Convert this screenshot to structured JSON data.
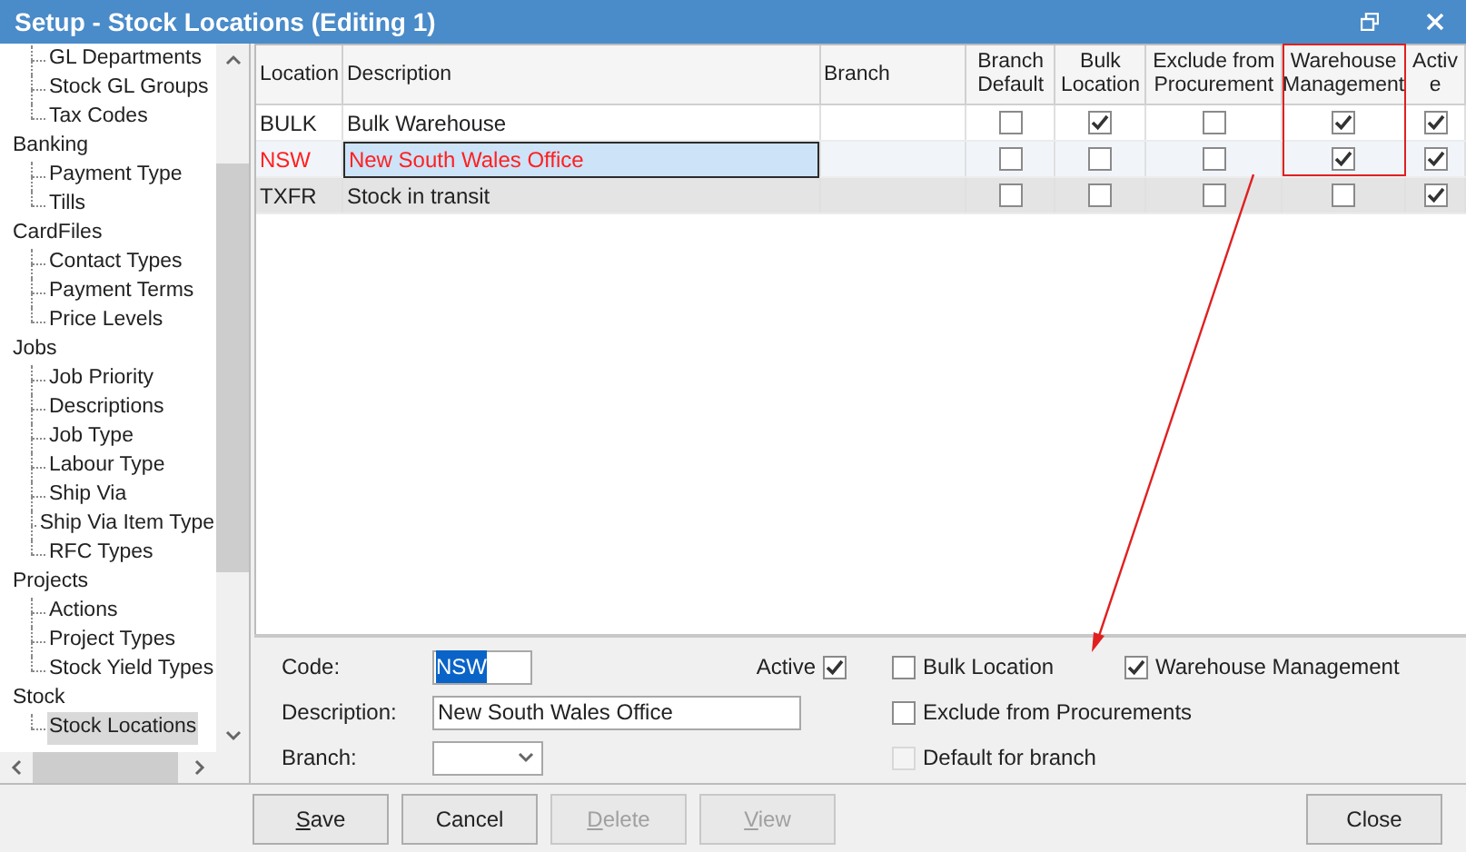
{
  "window": {
    "title": "Setup - Stock Locations (Editing 1)"
  },
  "sidebar": {
    "items": [
      {
        "children": [
          {
            "label": "GL Departments",
            "selected": false
          },
          {
            "label": "Stock GL Groups",
            "selected": false
          },
          {
            "label": "Tax Codes",
            "selected": false
          }
        ]
      },
      {
        "label": "Banking",
        "children": [
          {
            "label": "Payment Type",
            "selected": false
          },
          {
            "label": "Tills",
            "selected": false
          }
        ]
      },
      {
        "label": "CardFiles",
        "children": [
          {
            "label": "Contact Types",
            "selected": false
          },
          {
            "label": "Payment Terms",
            "selected": false
          },
          {
            "label": "Price Levels",
            "selected": false
          }
        ]
      },
      {
        "label": "Jobs",
        "children": [
          {
            "label": "Job Priority",
            "selected": false
          },
          {
            "label": "Descriptions",
            "selected": false
          },
          {
            "label": "Job Type",
            "selected": false
          },
          {
            "label": "Labour Type",
            "selected": false
          },
          {
            "label": "Ship Via",
            "selected": false
          },
          {
            "label": "Ship Via Item Type",
            "selected": false
          },
          {
            "label": "RFC Types",
            "selected": false
          }
        ]
      },
      {
        "label": "Projects",
        "children": [
          {
            "label": "Actions",
            "selected": false
          },
          {
            "label": "Project Types",
            "selected": false
          },
          {
            "label": "Stock Yield Types",
            "selected": false
          }
        ]
      },
      {
        "label": "Stock",
        "children": [
          {
            "label": "Stock Locations",
            "selected": true
          }
        ]
      }
    ]
  },
  "table": {
    "columns": [
      "Location",
      "Description",
      "Branch",
      "Branch Default",
      "Bulk Location",
      "Exclude from Procurement",
      "Warehouse Management",
      "Active"
    ],
    "rows": [
      {
        "location": "BULK",
        "description": "Bulk Warehouse",
        "selected": false,
        "shaded": false,
        "branch_default": false,
        "bulk_location": true,
        "exclude": false,
        "warehouse": true,
        "active": true
      },
      {
        "location": "NSW",
        "description": "New South Wales Office",
        "selected": true,
        "shaded": false,
        "branch_default": false,
        "bulk_location": false,
        "exclude": false,
        "warehouse": true,
        "active": true
      },
      {
        "location": "TXFR",
        "description": "Stock in transit",
        "selected": false,
        "shaded": true,
        "branch_default": false,
        "bulk_location": false,
        "exclude": false,
        "warehouse": false,
        "active": true
      }
    ]
  },
  "detail": {
    "code_label": "Code:",
    "code": "NSW",
    "active_label": "Active",
    "active": true,
    "description_label": "Description:",
    "description": "New South Wales Office",
    "branch_label": "Branch:",
    "options": [
      {
        "label": "Bulk Location",
        "checked": false,
        "disabled": false
      },
      {
        "label": "Warehouse Management",
        "checked": true,
        "disabled": false
      },
      {
        "label": "Exclude from Procurements",
        "checked": false,
        "disabled": false
      },
      {
        "label": "Default for branch",
        "checked": false,
        "disabled": true
      }
    ]
  },
  "buttons": [
    {
      "label": "Save",
      "disabled": false,
      "mnemonic": true
    },
    {
      "label": "Cancel",
      "disabled": false,
      "mnemonic": false
    },
    {
      "label": "Delete",
      "disabled": true,
      "mnemonic": true
    },
    {
      "label": "View",
      "disabled": true,
      "mnemonic": true
    }
  ],
  "close_button": {
    "label": "Close",
    "disabled": false,
    "mnemonic": false
  }
}
